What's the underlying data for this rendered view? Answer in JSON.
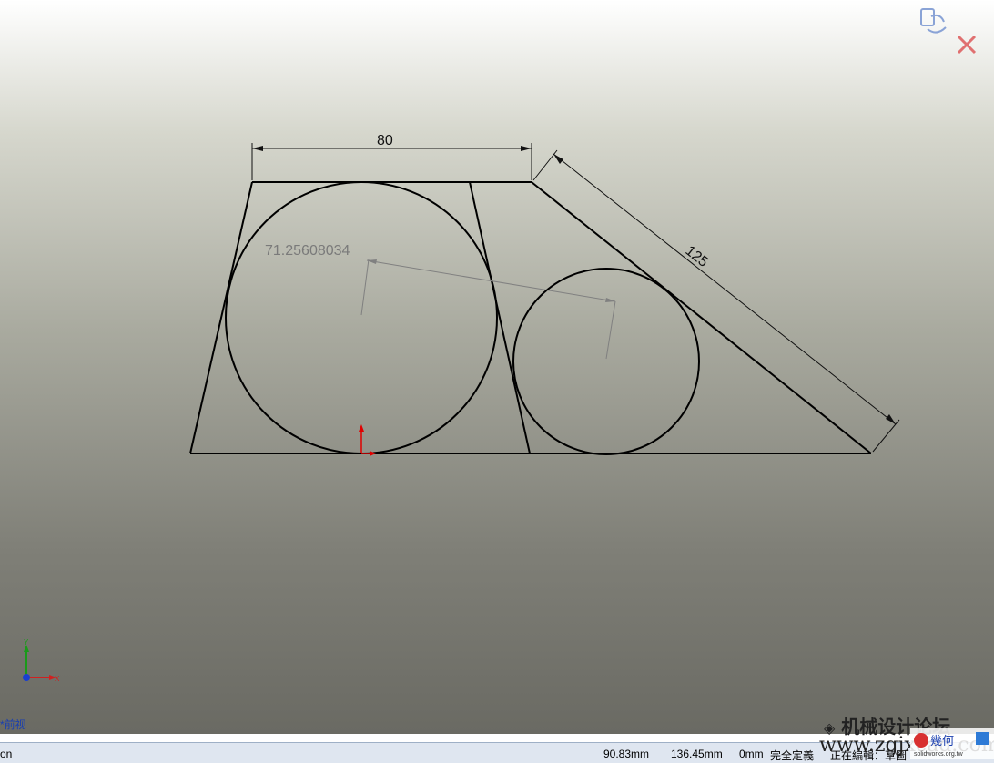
{
  "viewport": {
    "view_name": "*前视"
  },
  "sketch": {
    "dimensions": {
      "top_width": "80",
      "slant_length": "125",
      "circle_distance": "71.25608034"
    }
  },
  "status_bar": {
    "left_text": "on",
    "x_coord": "90.83mm",
    "y_coord": "136.45mm",
    "z_coord": "0mm",
    "definition_state": "完全定義",
    "editing_state": "正在編輯：草圖"
  },
  "watermark": {
    "forum_text": "机械设计论坛",
    "url_text": "www.zgjxcad.com",
    "logo_text": "幾何",
    "logo_sub": "solidworks.org.tw"
  },
  "icons": {
    "rebuild": "rebuild-icon",
    "exit_sketch": "close-icon",
    "triad": "axis-triad-icon",
    "origin": "sketch-origin-icon"
  },
  "colors": {
    "sketch_line": "#000000",
    "dimension": "#111111",
    "reference_dim": "#7a7a7a",
    "origin_red": "#e00000",
    "status_bg": "#dfe6f0"
  }
}
